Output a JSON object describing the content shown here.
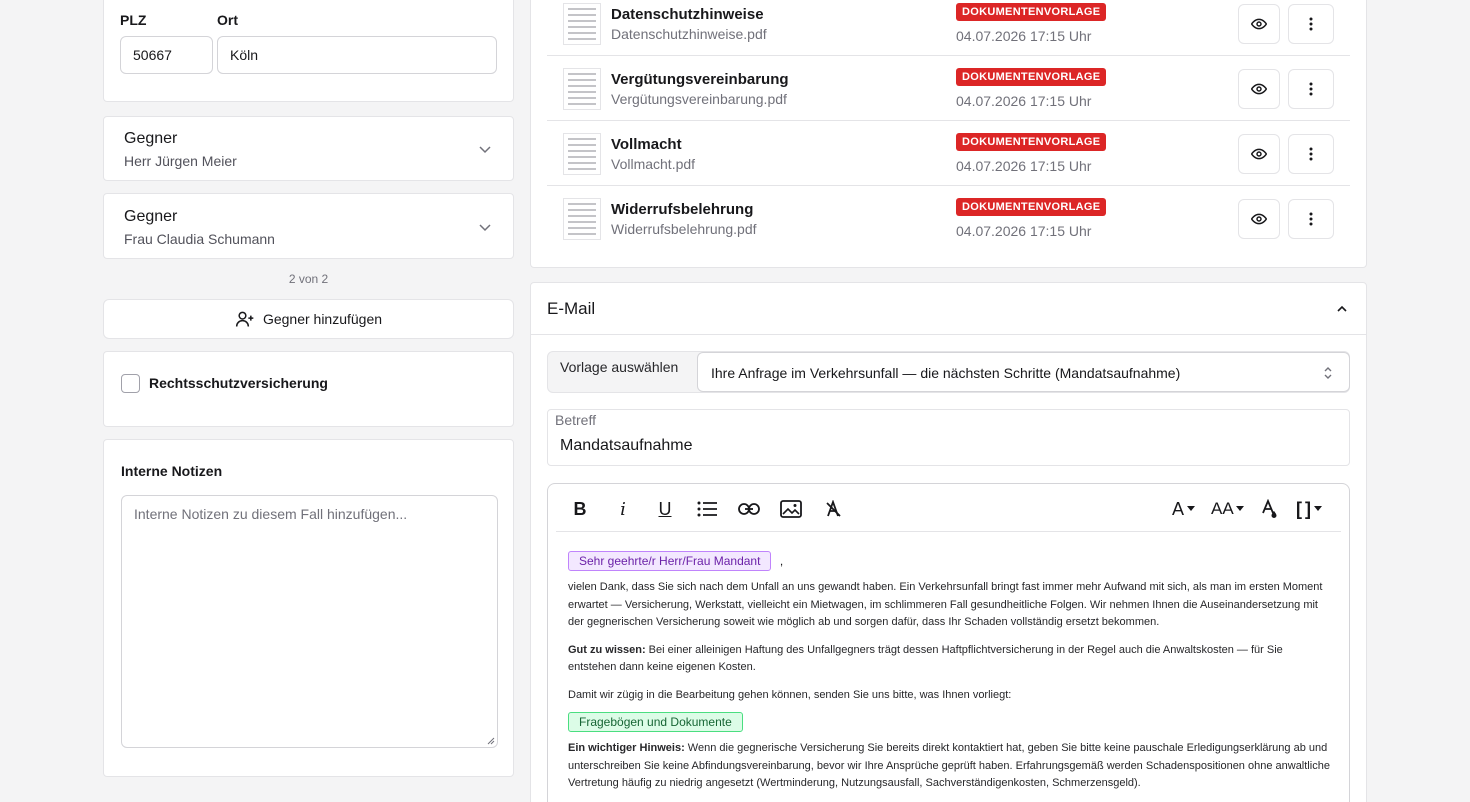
{
  "address": {
    "plz_label": "PLZ",
    "plz_value": "50667",
    "ort_label": "Ort",
    "ort_value": "Köln"
  },
  "gegner": [
    {
      "title": "Gegner",
      "name": "Herr Jürgen Meier"
    },
    {
      "title": "Gegner",
      "name": "Frau Claudia Schumann"
    }
  ],
  "pagination": "2 von 2",
  "add_gegner_label": "Gegner hinzufügen",
  "rechtsschutz_label": "Rechtsschutzversicherung",
  "notes": {
    "label": "Interne Notizen",
    "placeholder": "Interne Notizen zu diesem Fall hinzufügen..."
  },
  "documents": [
    {
      "name": "Datenschutzhinweise",
      "file": "Datenschutzhinweise.pdf",
      "badge": "DOKUMENTENVORLAGE",
      "date": "04.07.2026 17:15 Uhr"
    },
    {
      "name": "Vergütungsvereinbarung",
      "file": "Vergütungsvereinbarung.pdf",
      "badge": "DOKUMENTENVORLAGE",
      "date": "04.07.2026 17:15 Uhr"
    },
    {
      "name": "Vollmacht",
      "file": "Vollmacht.pdf",
      "badge": "DOKUMENTENVORLAGE",
      "date": "04.07.2026 17:15 Uhr"
    },
    {
      "name": "Widerrufsbelehrung",
      "file": "Widerrufsbelehrung.pdf",
      "badge": "DOKUMENTENVORLAGE",
      "date": "04.07.2026 17:15 Uhr"
    }
  ],
  "email": {
    "title": "E-Mail",
    "template_label": "Vorlage auswählen",
    "template_value": "Ihre Anfrage im Verkehrsunfall — die nächsten Schritte (Mandatsaufnahme)",
    "subject_label": "Betreff",
    "subject_value": "Mandatsaufnahme",
    "toolbar": {
      "bold": "B",
      "italic": "i",
      "underline": "U",
      "font": "A",
      "size": "AA",
      "brackets": "[ ]"
    },
    "body": {
      "greeting_tag": "Sehr geehrte/r Herr/Frau Mandant",
      "greeting_suffix": ",",
      "p1": "vielen Dank, dass Sie sich nach dem Unfall an uns gewandt haben. Ein Verkehrsunfall bringt fast immer mehr Aufwand mit sich, als man im ersten Moment erwartet — Versicherung, Werkstatt, vielleicht ein Mietwagen, im schlimmeren Fall gesundheitliche Folgen. Wir nehmen Ihnen die Auseinandersetzung mit der gegnerischen Versicherung soweit wie möglich ab und sorgen dafür, dass Ihr Schaden vollständig ersetzt bekommen.",
      "p2_bold": "Gut zu wissen:",
      "p2": " Bei einer alleinigen Haftung des Unfallgegners trägt dessen Haftpflichtversicherung in der Regel auch die Anwaltskosten — für Sie entstehen dann keine eigenen Kosten.",
      "p3": "Damit wir zügig in die Bearbeitung gehen können, senden Sie uns bitte, was Ihnen vorliegt:",
      "docs_tag": "Fragebögen und Dokumente",
      "p4_bold": "Ein wichtiger Hinweis:",
      "p4": " Wenn die gegnerische Versicherung Sie bereits direkt kontaktiert hat, geben Sie bitte keine pauschale Erledigungserklärung ab und unterschreiben Sie keine Abfindungsvereinbarung, bevor wir Ihre Ansprüche geprüft haben. Erfahrungsgemäß werden Schadenspositionen ohne anwaltliche Vertretung häufig zu niedrig angesetzt (Wertminderung, Nutzungsausfall, Sachverständigenkosten, Schmerzensgeld)."
    }
  }
}
